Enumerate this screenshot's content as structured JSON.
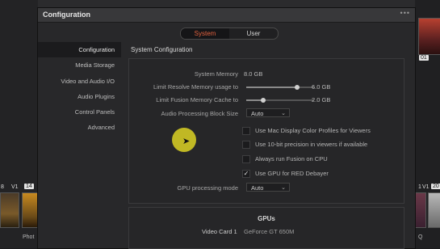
{
  "dialog": {
    "title": "Configuration",
    "menu_icon": "more-dots-icon",
    "menu_glyph": "•••"
  },
  "tabs": {
    "system": "System",
    "user": "User"
  },
  "sidebar": {
    "items": [
      {
        "label": "Configuration"
      },
      {
        "label": "Media Storage"
      },
      {
        "label": "Video and Audio I/O"
      },
      {
        "label": "Audio Plugins"
      },
      {
        "label": "Control Panels"
      },
      {
        "label": "Advanced"
      }
    ]
  },
  "system_config": {
    "section_title": "System Configuration",
    "system_memory_label": "System Memory",
    "system_memory_value": "8.0 GB",
    "resolve_memory_label": "Limit Resolve Memory usage to",
    "resolve_memory_value": "6.0 GB",
    "resolve_memory_fraction": 0.75,
    "fusion_cache_label": "Limit Fusion Memory Cache to",
    "fusion_cache_value": "2.0 GB",
    "fusion_cache_fraction": 0.25,
    "audio_block_label": "Audio Processing Block Size",
    "audio_block_value": "Auto",
    "checkboxes": [
      {
        "label": "Use Mac Display Color Profiles for Viewers",
        "checked": false
      },
      {
        "label": "Use 10-bit precision in viewers if available",
        "checked": false
      },
      {
        "label": "Always run Fusion on CPU",
        "checked": false
      },
      {
        "label": "Use GPU for RED Debayer",
        "checked": true
      }
    ],
    "check_glyph": "✓",
    "gpu_mode_label": "GPU processing mode",
    "gpu_mode_value": "Auto"
  },
  "gpus": {
    "title": "GPUs",
    "card_label": "Video Card 1",
    "card_value": "GeForce GT 650M"
  },
  "timeline": {
    "left_num_1": "8",
    "left_v1": "V1",
    "left_badge": "14",
    "left_caption": "Phot",
    "right_badge_top": "01",
    "right_num": "1",
    "right_v1": "V1",
    "right_badge": "20",
    "right_caption": "Q"
  },
  "colors": {
    "accent": "#e4623f",
    "cursor_halo": "#c8c024"
  }
}
